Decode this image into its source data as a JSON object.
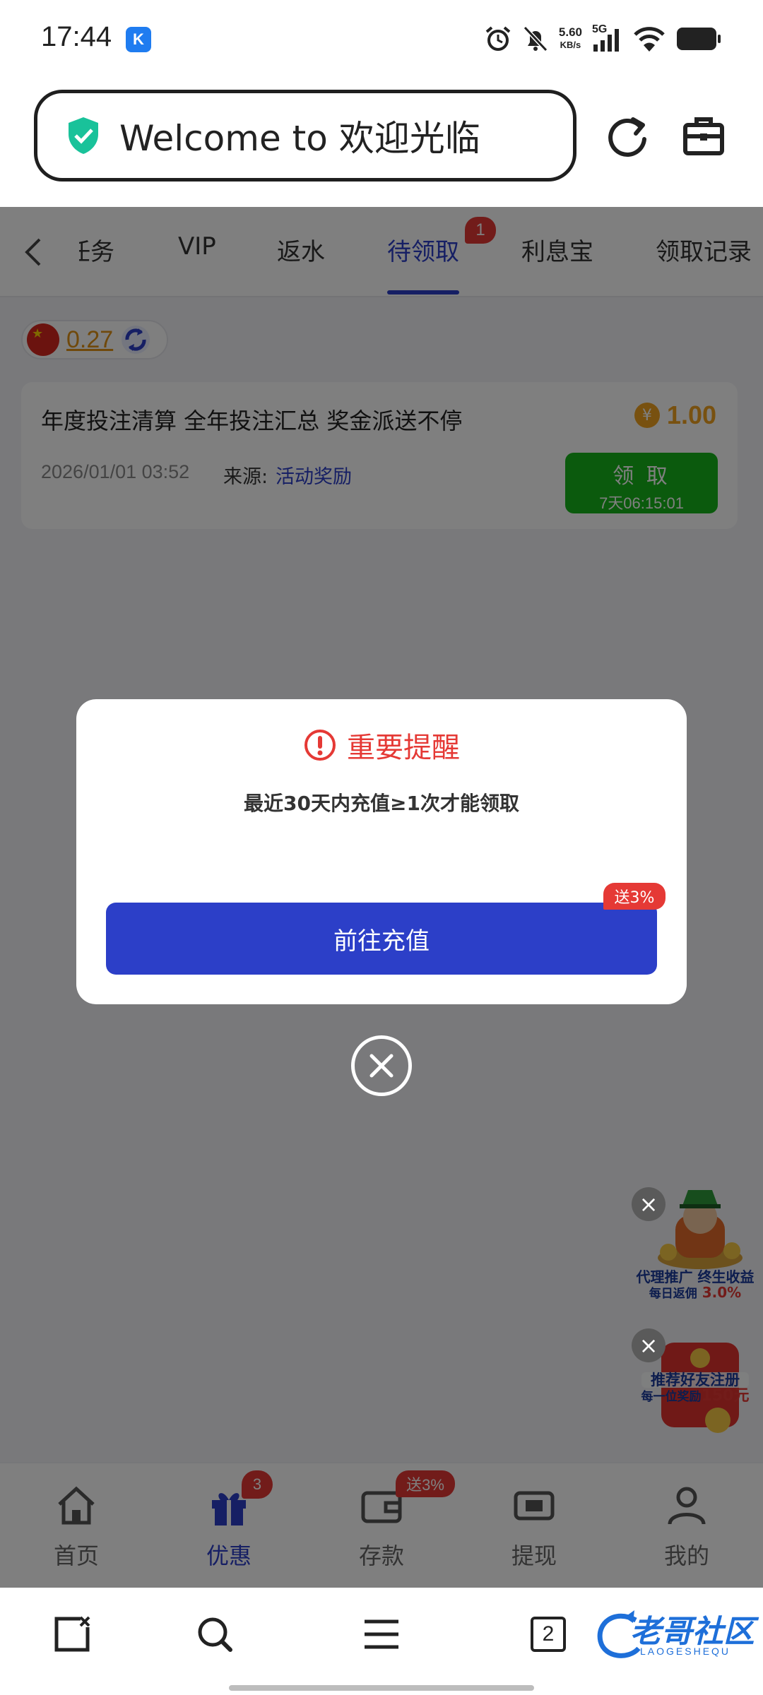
{
  "status_bar": {
    "time": "17:44",
    "app_badge": "K",
    "net_speed_value": "5.60",
    "net_speed_unit": "KB/s",
    "network": "5G"
  },
  "browser": {
    "url_text": "Welcome to 欢迎光临",
    "tab_count": "2"
  },
  "tabs": {
    "items": [
      "任务",
      "VIP",
      "返水",
      "待领取",
      "利息宝",
      "领取记录"
    ],
    "active": "待领取",
    "badge": "1"
  },
  "balance": {
    "value": "0.27"
  },
  "reward_card": {
    "title": "年度投注清算 全年投注汇总 奖金派送不停",
    "amount": "1.00",
    "currency_symbol": "¥",
    "date": "2026/01/01 03:52",
    "source_label": "来源:",
    "source": "活动奖励",
    "claim_label": "领 取",
    "claim_timer": "7天06:15:01"
  },
  "modal": {
    "title": "重要提醒",
    "message": "最近30天内充值≥1次才能领取",
    "button_label": "前往充值",
    "button_badge": "送3%"
  },
  "float_ads": {
    "agent_line1": "代理推广 终生收益",
    "agent_line2_prefix": "每日返佣",
    "agent_line2_value": "3.0%",
    "referral_line1": "推荐好友注册",
    "referral_line2_prefix": "每一位奖励",
    "referral_line2_value": "150元"
  },
  "bottom_nav": {
    "items": [
      "首页",
      "优惠",
      "存款",
      "提现",
      "我的"
    ],
    "active": "优惠",
    "promo_badge": "3",
    "deposit_badge": "送3%"
  },
  "watermark": {
    "text": "老哥社区",
    "sub": "LAOGESHEQU"
  },
  "colors": {
    "primary": "#2c3fc8",
    "claim_green": "#17b51a",
    "alert_red": "#e53935",
    "coin_orange": "#f1a321"
  }
}
